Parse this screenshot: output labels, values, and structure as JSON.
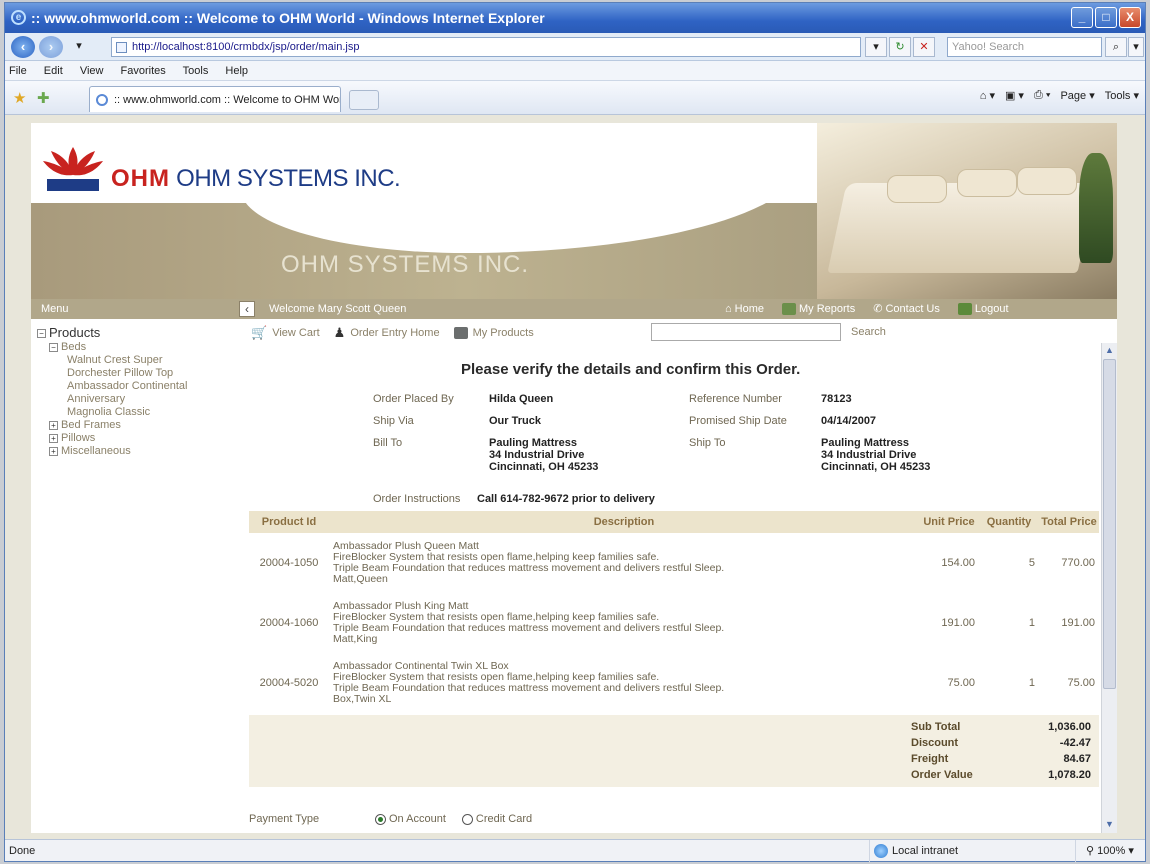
{
  "window": {
    "title": ":: www.ohmworld.com :: Welcome to OHM World - Windows Internet Explorer",
    "controls": {
      "minimize": "_",
      "maximize": "□",
      "close": "X"
    }
  },
  "browser": {
    "url": "http://localhost:8100/crmbdx/jsp/order/main.jsp",
    "search_placeholder": "Yahoo! Search",
    "menu": [
      "File",
      "Edit",
      "View",
      "Favorites",
      "Tools",
      "Help"
    ],
    "tab_title": ":: www.ohmworld.com :: Welcome to OHM World",
    "tools": {
      "page": "Page",
      "tools": "Tools"
    }
  },
  "banner": {
    "brand_mark": "OHM",
    "company": "OHM SYSTEMS INC.",
    "watermark": "OHM SYSTEMS INC."
  },
  "nav": {
    "menu_label": "Menu",
    "welcome": "Welcome Mary Scott Queen",
    "links": {
      "home": "Home",
      "reports": "My Reports",
      "contact": "Contact Us",
      "logout": "Logout"
    }
  },
  "sidebar": {
    "root": "Products",
    "beds_label": "Beds",
    "beds": [
      "Walnut Crest Super",
      "Dorchester Pillow Top",
      "Ambassador Continental",
      "Anniversary",
      "Magnolia Classic"
    ],
    "collapsed": [
      "Bed Frames",
      "Pillows",
      "Miscellaneous"
    ]
  },
  "toolbar": {
    "view_cart": "View Cart",
    "order_entry": "Order Entry Home",
    "my_products": "My Products",
    "search_label": "Search"
  },
  "order": {
    "heading": "Please verify the details and confirm this Order.",
    "placed_by_label": "Order Placed By",
    "placed_by": "Hilda Queen",
    "reference_label": "Reference Number",
    "reference": "78123",
    "ship_via_label": "Ship Via",
    "ship_via": "Our Truck",
    "ship_date_label": "Promised Ship Date",
    "ship_date": "04/14/2007",
    "bill_to_label": "Bill To",
    "bill_to": [
      "Pauling Mattress",
      "34 Industrial Drive",
      "Cincinnati, OH 45233"
    ],
    "ship_to_label": "Ship To",
    "ship_to": [
      "Pauling Mattress",
      "34 Industrial Drive",
      "Cincinnati, OH 45233"
    ],
    "instructions_label": "Order Instructions",
    "instructions": "Call 614-782-9672 prior to delivery"
  },
  "table": {
    "headers": [
      "Product Id",
      "Description",
      "Unit Price",
      "Quantity",
      "Total Price"
    ],
    "rows": [
      {
        "id": "20004-1050",
        "desc": [
          "Ambassador Plush Queen Matt",
          "FireBlocker System that resists open flame,helping keep families safe.",
          "Triple Beam Foundation that reduces mattress movement and delivers restful Sleep.",
          "Matt,Queen"
        ],
        "unit": "154.00",
        "qty": "5",
        "total": "770.00"
      },
      {
        "id": "20004-1060",
        "desc": [
          "Ambassador Plush King Matt",
          "FireBlocker System that resists open flame,helping keep families safe.",
          "Triple Beam Foundation that reduces mattress movement and delivers restful Sleep.",
          "Matt,King"
        ],
        "unit": "191.00",
        "qty": "1",
        "total": "191.00"
      },
      {
        "id": "20004-5020",
        "desc": [
          "Ambassador Continental Twin XL Box",
          "FireBlocker System that resists open flame,helping keep families safe.",
          "Triple Beam Foundation that reduces mattress movement and delivers restful Sleep.",
          "Box,Twin XL"
        ],
        "unit": "75.00",
        "qty": "1",
        "total": "75.00"
      }
    ]
  },
  "totals": {
    "sub_total_label": "Sub Total",
    "sub_total": "1,036.00",
    "discount_label": "Discount",
    "discount": "-42.47",
    "freight_label": "Freight",
    "freight": "84.67",
    "order_value_label": "Order Value",
    "order_value": "1,078.20"
  },
  "payment": {
    "label": "Payment Type",
    "options": [
      "On Account",
      "Credit Card"
    ],
    "selected": "On Account"
  },
  "status": {
    "text": "Done",
    "zone": "Local intranet",
    "zoom": "100%"
  },
  "colors": {
    "accent": "#b1a78a",
    "brand_red": "#c8231f",
    "brand_blue": "#1e3c86"
  }
}
